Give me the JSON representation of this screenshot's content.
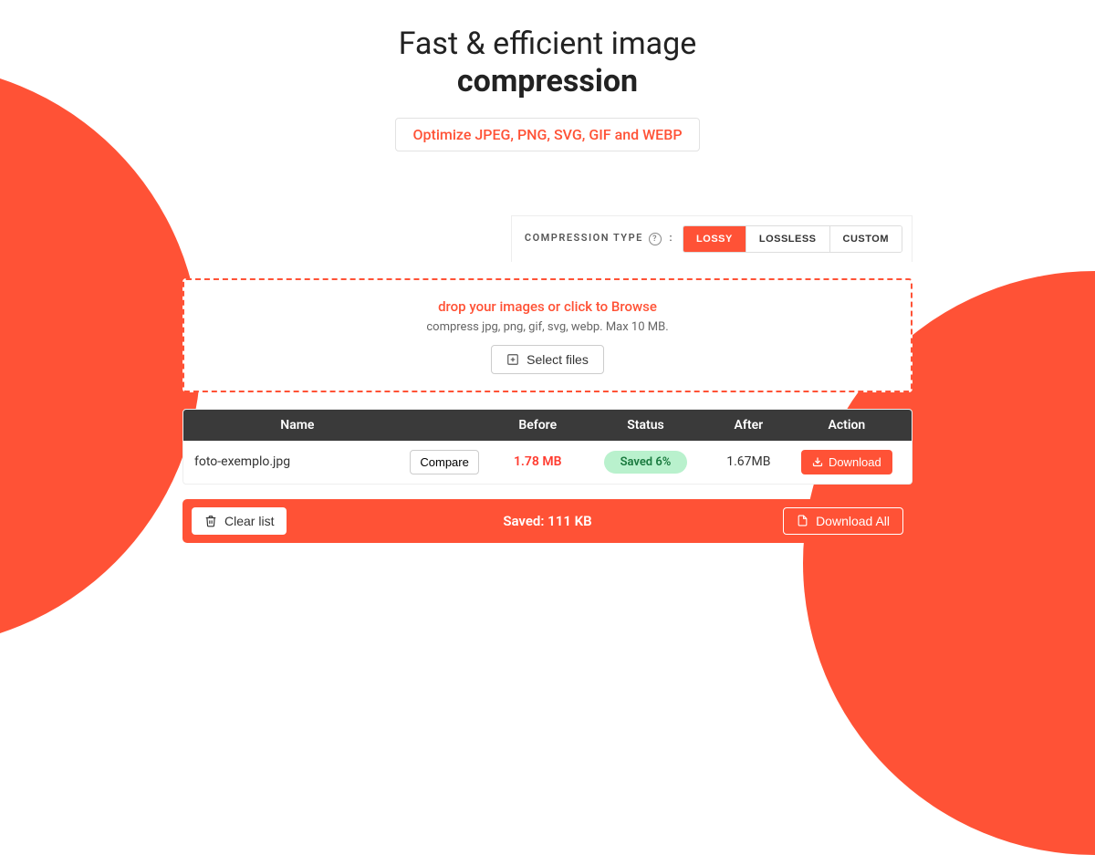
{
  "hero": {
    "title_line1": "Fast & efficient image",
    "title_line2": "compression",
    "subtitle": "Optimize JPEG, PNG, SVG, GIF and WEBP"
  },
  "compression_type": {
    "label": "COMPRESSION TYPE",
    "options": [
      "LOSSY",
      "LOSSLESS",
      "CUSTOM"
    ],
    "active": "LOSSY"
  },
  "dropzone": {
    "headline": "drop your images or click to Browse",
    "subtext": "compress jpg, png, gif, svg, webp. Max 10 MB.",
    "select_button": "Select files"
  },
  "table": {
    "headers": {
      "name": "Name",
      "before": "Before",
      "status": "Status",
      "after": "After",
      "action": "Action"
    },
    "rows": [
      {
        "name": "foto-exemplo.jpg",
        "compare": "Compare",
        "before": "1.78 MB",
        "status": "Saved 6%",
        "after": "1.67MB",
        "download": "Download"
      }
    ]
  },
  "footer": {
    "clear": "Clear list",
    "saved": "Saved: 111 KB",
    "download_all": "Download All"
  }
}
